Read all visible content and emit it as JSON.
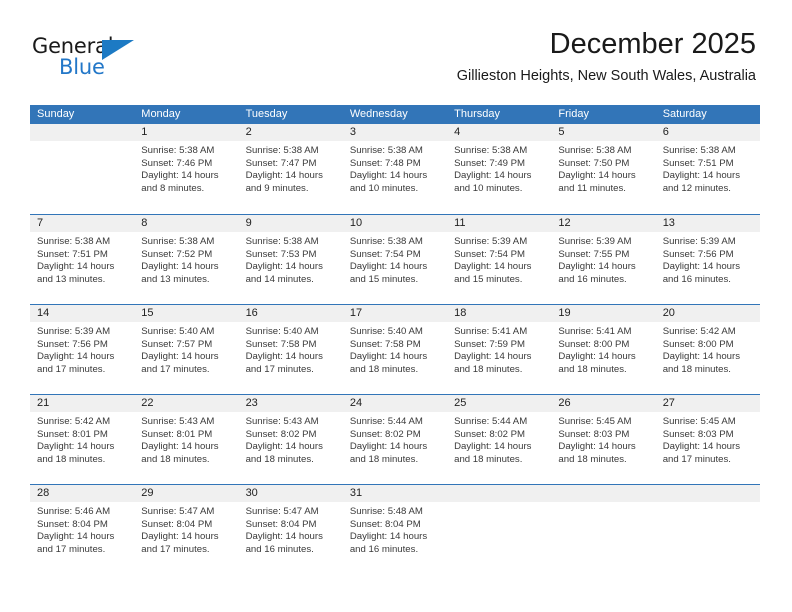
{
  "brand": {
    "name_part1": "General",
    "name_part2": "Blue"
  },
  "header": {
    "title": "December 2025",
    "location": "Gillieston Heights, New South Wales, Australia"
  },
  "calendar": {
    "weekday_headers": [
      "Sunday",
      "Monday",
      "Tuesday",
      "Wednesday",
      "Thursday",
      "Friday",
      "Saturday"
    ],
    "colors": {
      "header_blue": "#3275b8",
      "daynum_bg": "#f0f0f0",
      "brand_blue": "#2277c8"
    },
    "weeks": [
      [
        {
          "day": "",
          "sunrise": "",
          "sunset": "",
          "daylight": "",
          "empty": true
        },
        {
          "day": "1",
          "sunrise": "Sunrise: 5:38 AM",
          "sunset": "Sunset: 7:46 PM",
          "daylight": "Daylight: 14 hours and 8 minutes."
        },
        {
          "day": "2",
          "sunrise": "Sunrise: 5:38 AM",
          "sunset": "Sunset: 7:47 PM",
          "daylight": "Daylight: 14 hours and 9 minutes."
        },
        {
          "day": "3",
          "sunrise": "Sunrise: 5:38 AM",
          "sunset": "Sunset: 7:48 PM",
          "daylight": "Daylight: 14 hours and 10 minutes."
        },
        {
          "day": "4",
          "sunrise": "Sunrise: 5:38 AM",
          "sunset": "Sunset: 7:49 PM",
          "daylight": "Daylight: 14 hours and 10 minutes."
        },
        {
          "day": "5",
          "sunrise": "Sunrise: 5:38 AM",
          "sunset": "Sunset: 7:50 PM",
          "daylight": "Daylight: 14 hours and 11 minutes."
        },
        {
          "day": "6",
          "sunrise": "Sunrise: 5:38 AM",
          "sunset": "Sunset: 7:51 PM",
          "daylight": "Daylight: 14 hours and 12 minutes."
        }
      ],
      [
        {
          "day": "7",
          "sunrise": "Sunrise: 5:38 AM",
          "sunset": "Sunset: 7:51 PM",
          "daylight": "Daylight: 14 hours and 13 minutes."
        },
        {
          "day": "8",
          "sunrise": "Sunrise: 5:38 AM",
          "sunset": "Sunset: 7:52 PM",
          "daylight": "Daylight: 14 hours and 13 minutes."
        },
        {
          "day": "9",
          "sunrise": "Sunrise: 5:38 AM",
          "sunset": "Sunset: 7:53 PM",
          "daylight": "Daylight: 14 hours and 14 minutes."
        },
        {
          "day": "10",
          "sunrise": "Sunrise: 5:38 AM",
          "sunset": "Sunset: 7:54 PM",
          "daylight": "Daylight: 14 hours and 15 minutes."
        },
        {
          "day": "11",
          "sunrise": "Sunrise: 5:39 AM",
          "sunset": "Sunset: 7:54 PM",
          "daylight": "Daylight: 14 hours and 15 minutes."
        },
        {
          "day": "12",
          "sunrise": "Sunrise: 5:39 AM",
          "sunset": "Sunset: 7:55 PM",
          "daylight": "Daylight: 14 hours and 16 minutes."
        },
        {
          "day": "13",
          "sunrise": "Sunrise: 5:39 AM",
          "sunset": "Sunset: 7:56 PM",
          "daylight": "Daylight: 14 hours and 16 minutes."
        }
      ],
      [
        {
          "day": "14",
          "sunrise": "Sunrise: 5:39 AM",
          "sunset": "Sunset: 7:56 PM",
          "daylight": "Daylight: 14 hours and 17 minutes."
        },
        {
          "day": "15",
          "sunrise": "Sunrise: 5:40 AM",
          "sunset": "Sunset: 7:57 PM",
          "daylight": "Daylight: 14 hours and 17 minutes."
        },
        {
          "day": "16",
          "sunrise": "Sunrise: 5:40 AM",
          "sunset": "Sunset: 7:58 PM",
          "daylight": "Daylight: 14 hours and 17 minutes."
        },
        {
          "day": "17",
          "sunrise": "Sunrise: 5:40 AM",
          "sunset": "Sunset: 7:58 PM",
          "daylight": "Daylight: 14 hours and 18 minutes."
        },
        {
          "day": "18",
          "sunrise": "Sunrise: 5:41 AM",
          "sunset": "Sunset: 7:59 PM",
          "daylight": "Daylight: 14 hours and 18 minutes."
        },
        {
          "day": "19",
          "sunrise": "Sunrise: 5:41 AM",
          "sunset": "Sunset: 8:00 PM",
          "daylight": "Daylight: 14 hours and 18 minutes."
        },
        {
          "day": "20",
          "sunrise": "Sunrise: 5:42 AM",
          "sunset": "Sunset: 8:00 PM",
          "daylight": "Daylight: 14 hours and 18 minutes."
        }
      ],
      [
        {
          "day": "21",
          "sunrise": "Sunrise: 5:42 AM",
          "sunset": "Sunset: 8:01 PM",
          "daylight": "Daylight: 14 hours and 18 minutes."
        },
        {
          "day": "22",
          "sunrise": "Sunrise: 5:43 AM",
          "sunset": "Sunset: 8:01 PM",
          "daylight": "Daylight: 14 hours and 18 minutes."
        },
        {
          "day": "23",
          "sunrise": "Sunrise: 5:43 AM",
          "sunset": "Sunset: 8:02 PM",
          "daylight": "Daylight: 14 hours and 18 minutes."
        },
        {
          "day": "24",
          "sunrise": "Sunrise: 5:44 AM",
          "sunset": "Sunset: 8:02 PM",
          "daylight": "Daylight: 14 hours and 18 minutes."
        },
        {
          "day": "25",
          "sunrise": "Sunrise: 5:44 AM",
          "sunset": "Sunset: 8:02 PM",
          "daylight": "Daylight: 14 hours and 18 minutes."
        },
        {
          "day": "26",
          "sunrise": "Sunrise: 5:45 AM",
          "sunset": "Sunset: 8:03 PM",
          "daylight": "Daylight: 14 hours and 18 minutes."
        },
        {
          "day": "27",
          "sunrise": "Sunrise: 5:45 AM",
          "sunset": "Sunset: 8:03 PM",
          "daylight": "Daylight: 14 hours and 17 minutes."
        }
      ],
      [
        {
          "day": "28",
          "sunrise": "Sunrise: 5:46 AM",
          "sunset": "Sunset: 8:04 PM",
          "daylight": "Daylight: 14 hours and 17 minutes."
        },
        {
          "day": "29",
          "sunrise": "Sunrise: 5:47 AM",
          "sunset": "Sunset: 8:04 PM",
          "daylight": "Daylight: 14 hours and 17 minutes."
        },
        {
          "day": "30",
          "sunrise": "Sunrise: 5:47 AM",
          "sunset": "Sunset: 8:04 PM",
          "daylight": "Daylight: 14 hours and 16 minutes."
        },
        {
          "day": "31",
          "sunrise": "Sunrise: 5:48 AM",
          "sunset": "Sunset: 8:04 PM",
          "daylight": "Daylight: 14 hours and 16 minutes."
        },
        {
          "day": "",
          "sunrise": "",
          "sunset": "",
          "daylight": "",
          "empty": true
        },
        {
          "day": "",
          "sunrise": "",
          "sunset": "",
          "daylight": "",
          "empty": true
        },
        {
          "day": "",
          "sunrise": "",
          "sunset": "",
          "daylight": "",
          "empty": true
        }
      ]
    ]
  }
}
